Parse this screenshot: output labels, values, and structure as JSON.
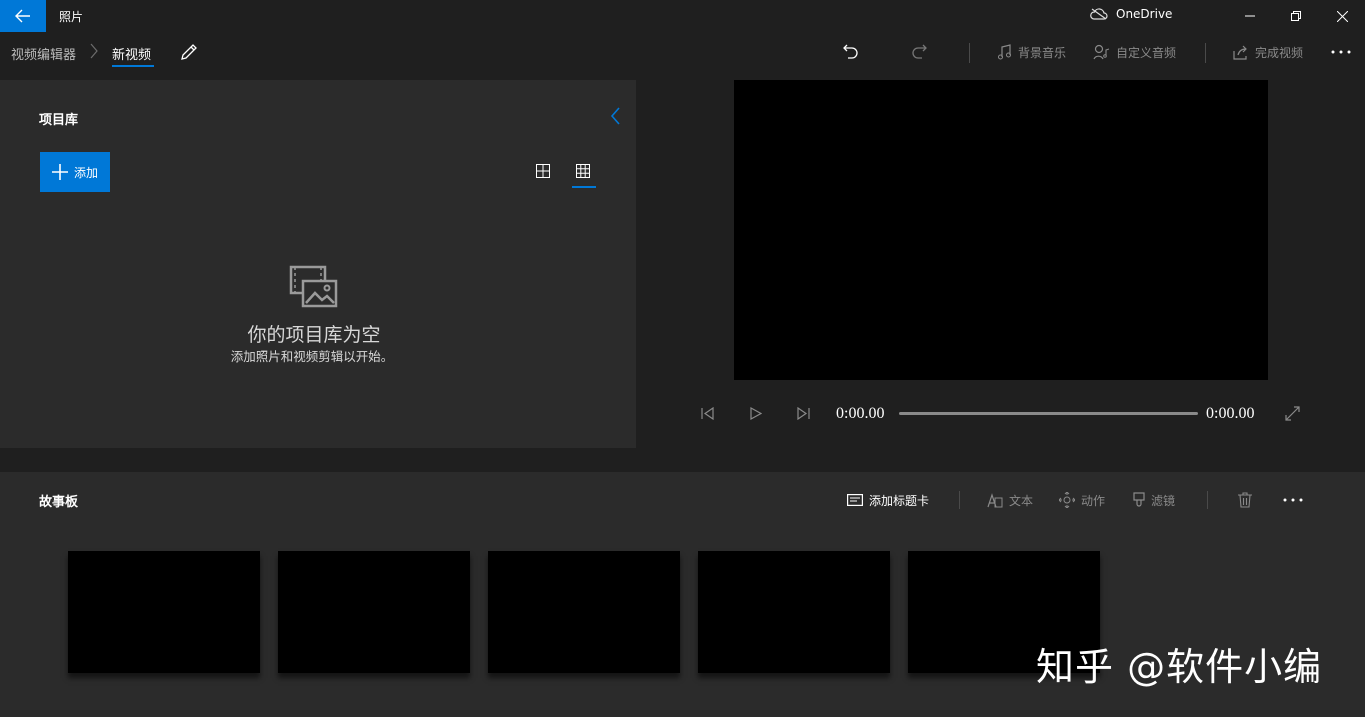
{
  "titlebar": {
    "app_title": "照片",
    "onedrive_label": "OneDrive"
  },
  "breadcrumb": {
    "root": "视频编辑器",
    "current": "新视频"
  },
  "toolbar": {
    "background_music": "背景音乐",
    "custom_audio": "自定义音频",
    "finish_video": "完成视频"
  },
  "library": {
    "title": "项目库",
    "add_label": "添加",
    "empty_title": "你的项目库为空",
    "empty_subtitle": "添加照片和视频剪辑以开始。"
  },
  "player": {
    "current_time": "0:00.00",
    "total_time": "0:00.00"
  },
  "storyboard": {
    "title": "故事板",
    "add_title_card": "添加标题卡",
    "text": "文本",
    "motion": "动作",
    "filters": "滤镜"
  },
  "watermark": "知乎 @软件小编",
  "colors": {
    "accent": "#0078d7",
    "background": "#1f1f1f",
    "panel": "#2b2b2b"
  }
}
